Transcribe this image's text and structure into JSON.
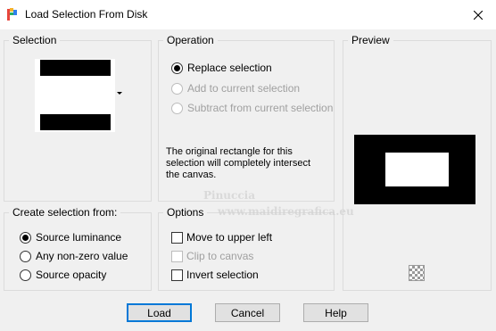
{
  "window": {
    "title": "Load Selection From Disk"
  },
  "selection": {
    "group_label": "Selection"
  },
  "operation": {
    "group_label": "Operation",
    "options": [
      {
        "label": "Replace selection",
        "checked": true,
        "disabled": false
      },
      {
        "label": "Add to current selection",
        "checked": false,
        "disabled": true
      },
      {
        "label": "Subtract from current selection",
        "checked": false,
        "disabled": true
      }
    ],
    "info_lines": [
      "The original rectangle for this",
      "selection will completely intersect",
      "the canvas."
    ]
  },
  "preview": {
    "group_label": "Preview"
  },
  "create_from": {
    "group_label": "Create selection from:",
    "options": [
      {
        "label": "Source luminance",
        "checked": true
      },
      {
        "label": "Any non-zero value",
        "checked": false
      },
      {
        "label": "Source opacity",
        "checked": false
      }
    ]
  },
  "options_group": {
    "group_label": "Options",
    "items": [
      {
        "label": "Move to upper left",
        "checked": false,
        "disabled": false
      },
      {
        "label": "Clip to canvas",
        "checked": false,
        "disabled": true
      },
      {
        "label": "Invert selection",
        "checked": false,
        "disabled": false
      }
    ]
  },
  "watermark": {
    "line1": "Pinuccia",
    "line2": "www.maidiregrafica.eu"
  },
  "buttons": {
    "load": "Load",
    "cancel": "Cancel",
    "help": "Help"
  }
}
